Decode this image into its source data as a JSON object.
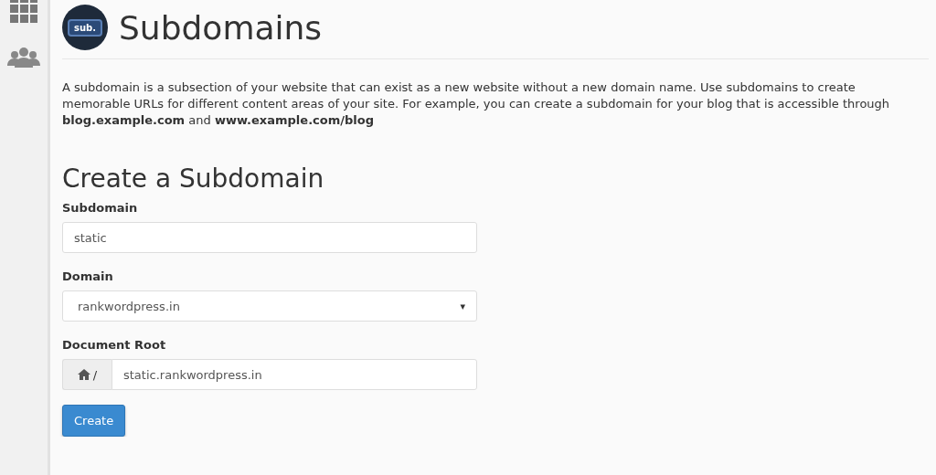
{
  "header": {
    "logo_text": "sub.",
    "title": "Subdomains"
  },
  "description": "A subdomain is a subsection of your website that can exist as a new website without a new domain name. Use subdomains to create memorable URLs for different content areas of your site. For example, you can create a subdomain for your blog that is accessible through **blog.example.com** and **www.example.com/blog**",
  "form": {
    "heading": "Create a Subdomain",
    "fields": [
      {
        "kind": "text",
        "label": "Subdomain",
        "value": "static"
      },
      {
        "kind": "select",
        "label": "Domain",
        "value": "rankwordpress.in",
        "caret": "▾"
      },
      {
        "kind": "addon",
        "label": "Document Root",
        "prefix": "/",
        "value": "static.rankwordpress.in"
      }
    ],
    "button": "Create"
  }
}
